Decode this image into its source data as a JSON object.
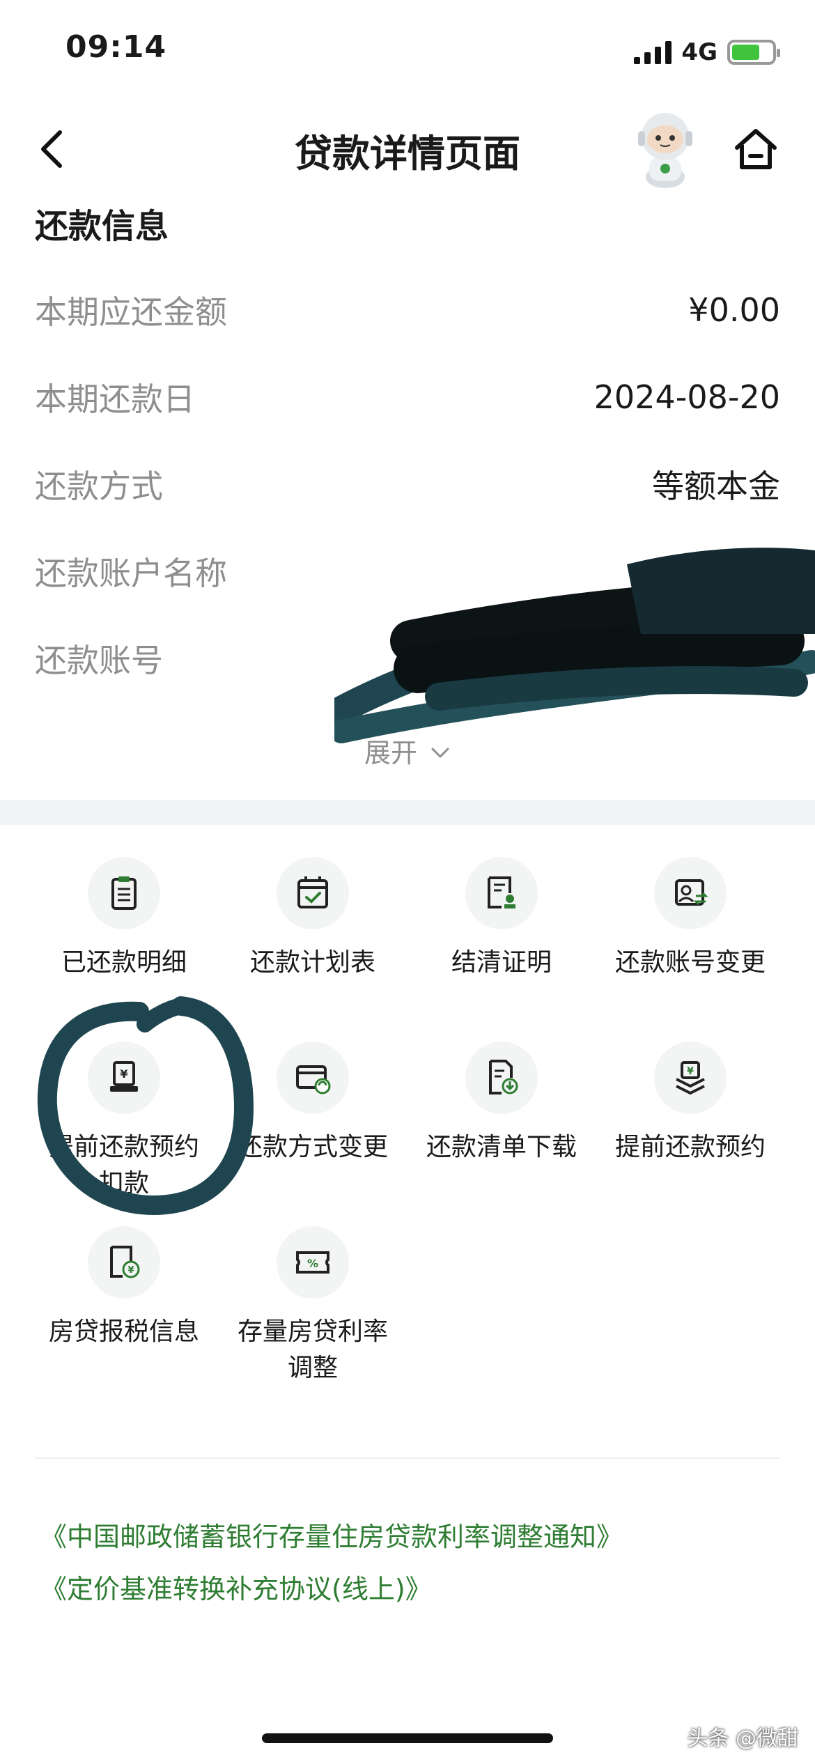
{
  "status_bar": {
    "time": "09:14",
    "network": "4G",
    "battery_level": 0.7
  },
  "nav": {
    "title": "贷款详情页面",
    "icons": [
      "back-icon",
      "robot-avatar-icon",
      "home-icon"
    ]
  },
  "repayment_info": {
    "title": "还款信息",
    "rows": [
      {
        "label": "本期应还金额",
        "value": "¥0.00"
      },
      {
        "label": "本期还款日",
        "value": "2024-08-20"
      },
      {
        "label": "还款方式",
        "value": "等额本金"
      },
      {
        "label": "还款账户名称",
        "value": ""
      },
      {
        "label": "还款账号",
        "value": ""
      }
    ],
    "expand_label": "展开"
  },
  "services": [
    {
      "label": "已还款明细",
      "icon": "clipboard-icon"
    },
    {
      "label": "还款计划表",
      "icon": "calendar-check-icon"
    },
    {
      "label": "结清证明",
      "icon": "certificate-icon"
    },
    {
      "label": "还款账号变更",
      "icon": "account-change-icon"
    },
    {
      "label": "提前还款预约扣款",
      "icon": "yuan-document-icon"
    },
    {
      "label": "还款方式变更",
      "icon": "card-refresh-icon"
    },
    {
      "label": "还款清单下载",
      "icon": "document-download-icon"
    },
    {
      "label": "提前还款预约",
      "icon": "yuan-stack-icon"
    },
    {
      "label": "房贷报税信息",
      "icon": "tax-document-icon"
    },
    {
      "label": "存量房贷利率调整",
      "icon": "percent-ticket-icon"
    }
  ],
  "links": [
    "《中国邮政储蓄银行存量住房贷款利率调整通知》",
    "《定价基准转换补充协议(线上)》"
  ],
  "watermark": "头条 @微甜",
  "colors": {
    "accent": "#2e7d32",
    "label_gray": "#8e8e8e",
    "background_band": "#f1f3f6"
  }
}
